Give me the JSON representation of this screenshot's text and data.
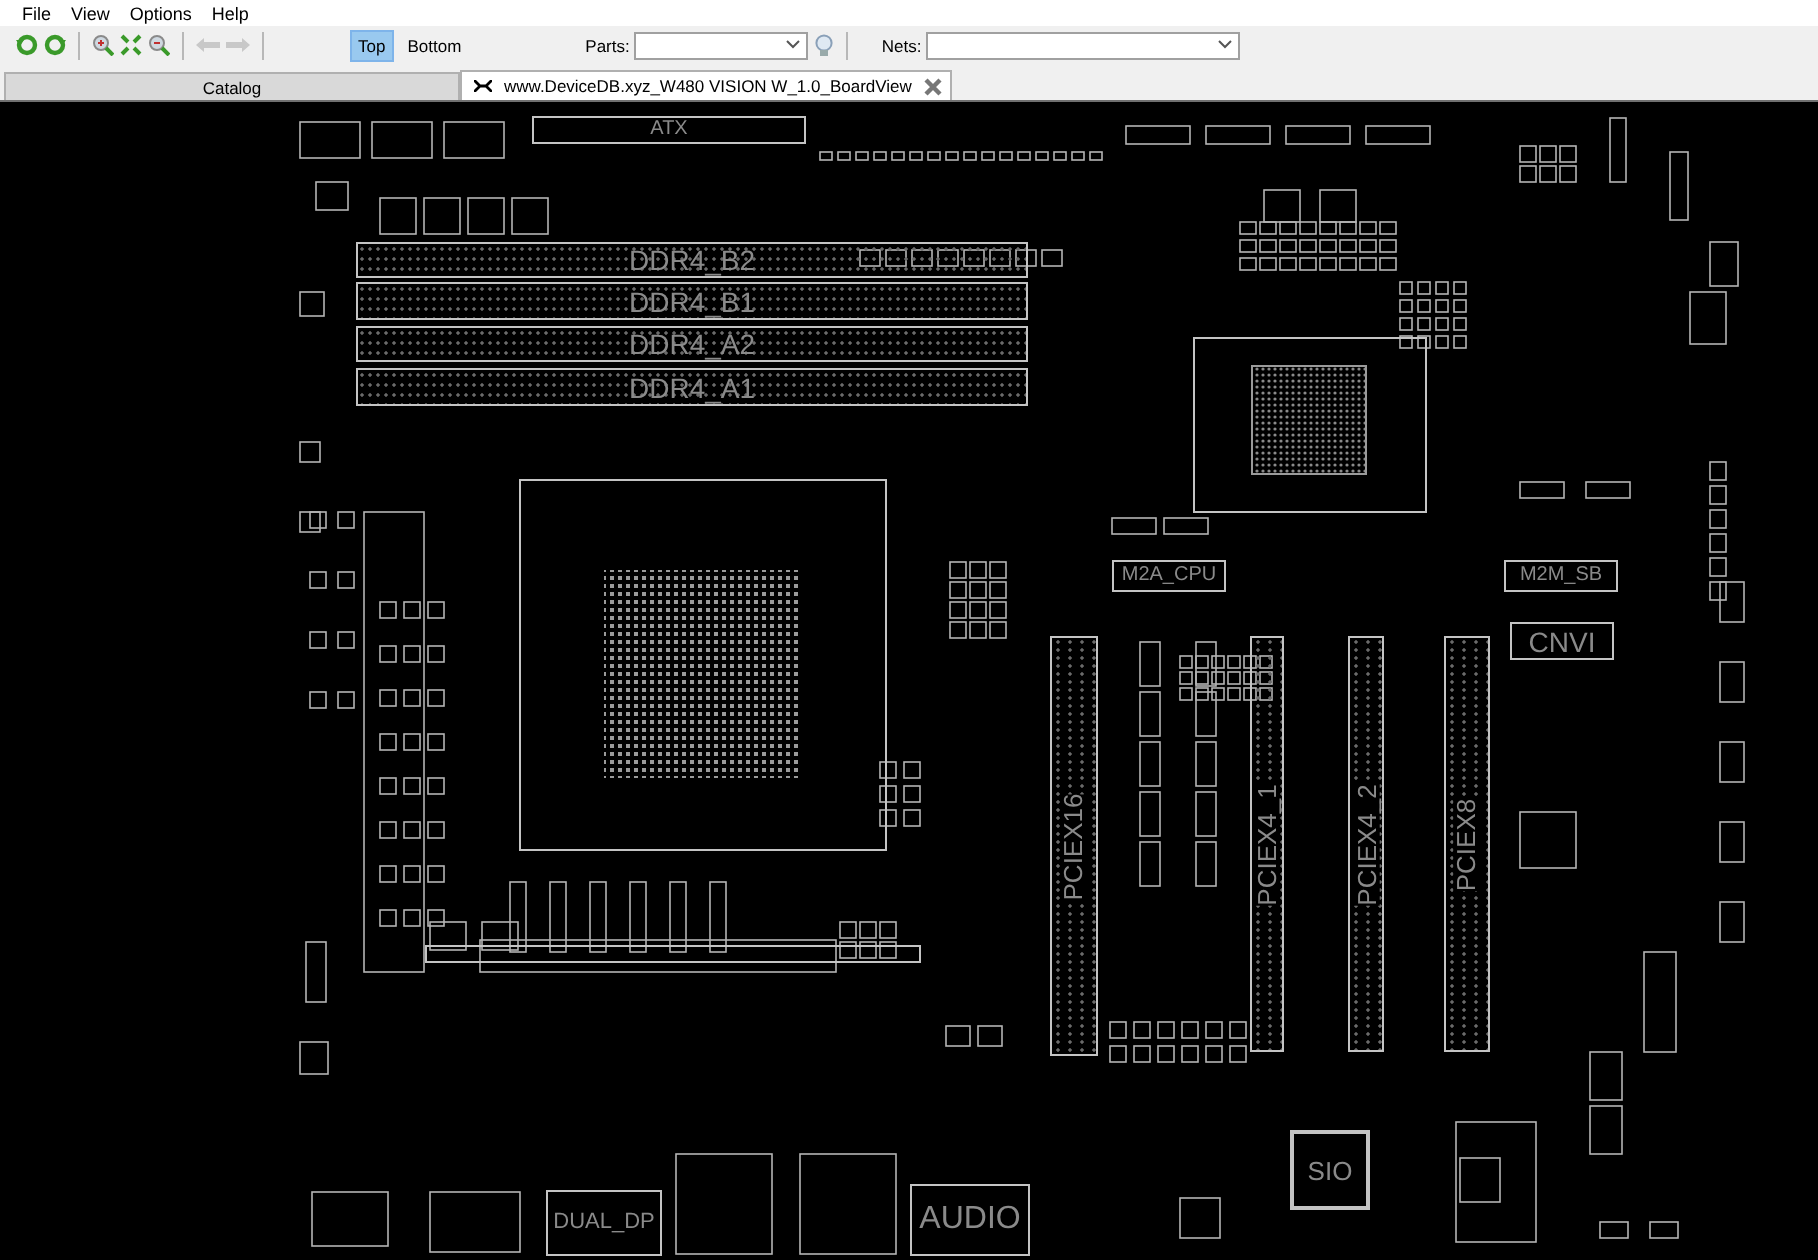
{
  "menu": [
    "File",
    "View",
    "Options",
    "Help"
  ],
  "toolbar": {
    "side": [
      {
        "label": "Top",
        "selected": true
      },
      {
        "label": "Bottom",
        "selected": false
      }
    ],
    "parts_label": "Parts:",
    "nets_label": "Nets:"
  },
  "tabs": [
    {
      "label": "Catalog",
      "selected": false,
      "closable": false
    },
    {
      "label": "www.DeviceDB.xyz_W480 VISION W_1.0_BoardView",
      "selected": true,
      "closable": true
    }
  ],
  "board": {
    "parts": [
      {
        "kind": "connector",
        "label": "ATX"
      },
      {
        "kind": "dimm-slot",
        "label": "DDR4_B2"
      },
      {
        "kind": "dimm-slot",
        "label": "DDR4_B1"
      },
      {
        "kind": "dimm-slot",
        "label": "DDR4_A2"
      },
      {
        "kind": "dimm-slot",
        "label": "DDR4_A1"
      },
      {
        "kind": "m2-slot",
        "label": "M2A_CPU"
      },
      {
        "kind": "m2-slot",
        "label": "M2M_SB"
      },
      {
        "kind": "connector",
        "label": "CNVI"
      },
      {
        "kind": "pcie-slot",
        "label": "PCIEX16"
      },
      {
        "kind": "pcie-slot",
        "label": "PCIEX4_1"
      },
      {
        "kind": "pcie-slot",
        "label": "PCIEX4_2"
      },
      {
        "kind": "pcie-slot",
        "label": "PCIEX8"
      },
      {
        "kind": "chip",
        "label": "SIO"
      },
      {
        "kind": "connector",
        "label": "AUDIO"
      },
      {
        "kind": "connector",
        "label": "DUAL_DP"
      }
    ]
  }
}
